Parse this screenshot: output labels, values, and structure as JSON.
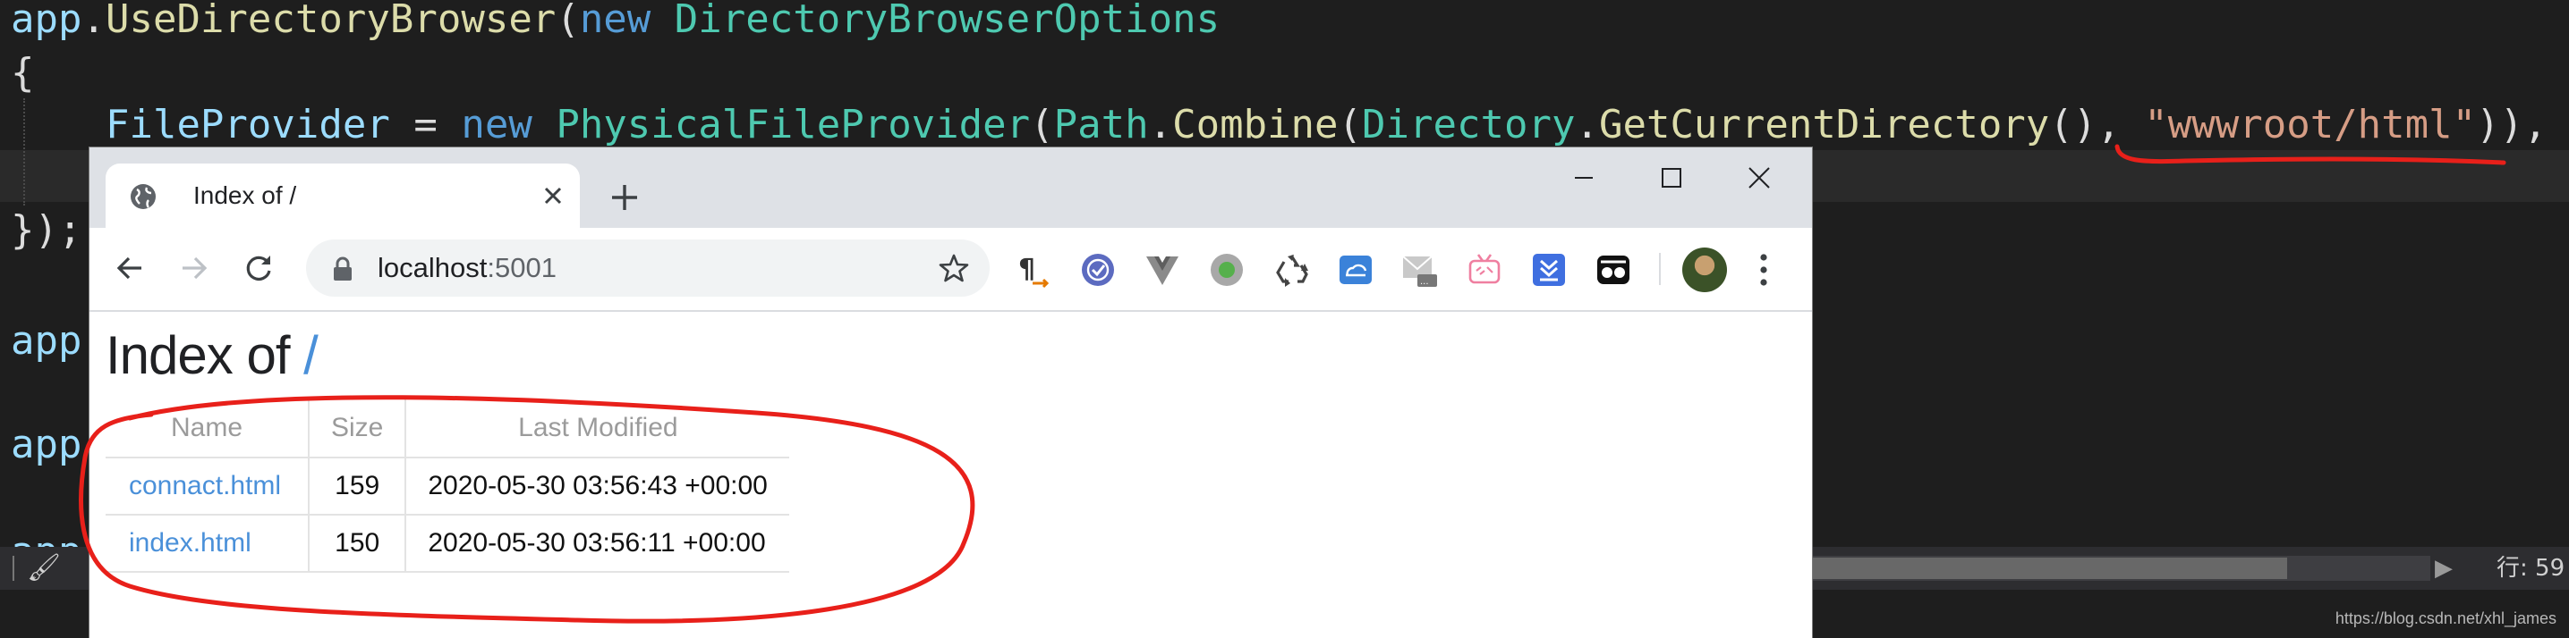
{
  "editor": {
    "line1": {
      "app": "app",
      "dot": ".",
      "method": "UseDirectoryBrowser",
      "paren": "(",
      "new_kw": "new",
      "options_type": "DirectoryBrowserOptions"
    },
    "line2": "{",
    "line3": {
      "prop": "FileProvider",
      "eq": " = ",
      "new_kw": "new",
      "provider_type": "PhysicalFileProvider",
      "paren1": "(",
      "path_cls": "Path",
      "dot1": ".",
      "combine": "Combine",
      "paren2": "(",
      "dir_cls": "Directory",
      "dot2": ".",
      "getcwd": "GetCurrentDirectory",
      "call": "()",
      "comma": ", ",
      "str": "\"wwwroot/html\"",
      "close": ")),"
    },
    "line5": "});",
    "line6": "app",
    "line7": "app",
    "line8": "app",
    "status_position": "行: 59",
    "watermark": "https://blog.csdn.net/xhl_james"
  },
  "browser": {
    "tab_title": "Index of /",
    "url_host": "localhost",
    "url_port": ":5001",
    "extensions": [
      "pilcrow-icon",
      "check-badge-icon",
      "vuejs-icon",
      "green-circle-icon",
      "recycle-icon",
      "cloud-sync-icon",
      "mail-icon",
      "tv-icon",
      "download-icon",
      "glasses-icon"
    ]
  },
  "page": {
    "heading": "Index of",
    "heading_link": "/",
    "table": {
      "headers": [
        "Name",
        "Size",
        "Last Modified"
      ],
      "rows": [
        {
          "name": "connact.html",
          "size": "159",
          "modified": "2020-05-30 03:56:43 +00:00"
        },
        {
          "name": "index.html",
          "size": "150",
          "modified": "2020-05-30 03:56:11 +00:00"
        }
      ]
    }
  },
  "colors": {
    "editor_bg": "#1e1e1e",
    "annotation_red": "#e8201a",
    "link_blue": "#4a90d9",
    "tabstrip_bg": "#dee1e6"
  }
}
